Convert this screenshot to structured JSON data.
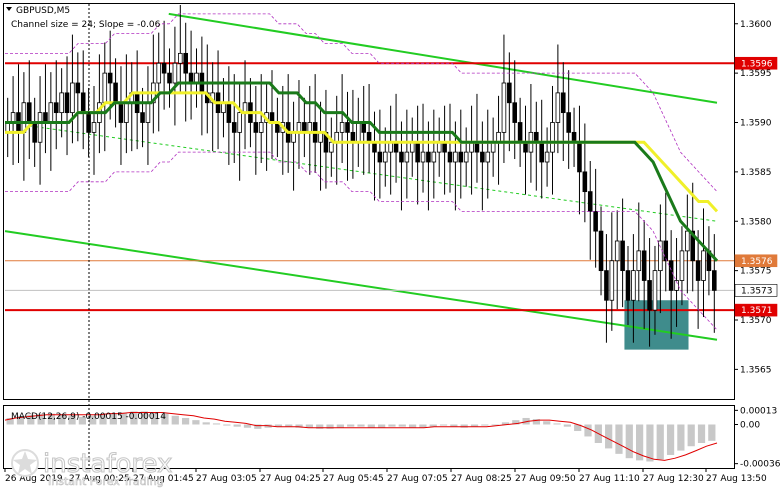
{
  "colors": {
    "background": "#ffffff",
    "bullish_bar": "#000000",
    "ema_fast": "#1a7a1a",
    "ema_slow": "#f0f02a",
    "channel": "#22cc22",
    "envelope": "#b030c0",
    "level": "#e00000",
    "current_level": "#e07a3a",
    "highlight_box": "#3f8c8c",
    "macd_hist": "#c8c8c8",
    "macd_signal": "#e00000"
  },
  "chart_data": [
    {
      "type": "candlestick",
      "title": "GBPUSD,M5",
      "subtitle": "Channel size = 24; Slope = -0.06",
      "ylim": [
        1.3562,
        1.3602
      ],
      "y_ticks": [
        "1.3600",
        "1.3595",
        "1.3590",
        "1.3585",
        "1.3580",
        "1.3575",
        "1.3570",
        "1.3565"
      ],
      "x_ticks": [
        "26 Aug 2019",
        "27 Aug 00:25",
        "27 Aug 01:45",
        "27 Aug 03:05",
        "27 Aug 04:25",
        "27 Aug 05:45",
        "27 Aug 07:05",
        "27 Aug 08:25",
        "27 Aug 09:50",
        "27 Aug 11:10",
        "27 Aug 12:30",
        "27 Aug 13:50"
      ],
      "price_tags": [
        {
          "name": "resistance",
          "value": "1.3596"
        },
        {
          "name": "current-level",
          "value": "1.3576"
        },
        {
          "name": "last-price",
          "value": "1.3573"
        },
        {
          "name": "support",
          "value": "1.3571"
        }
      ],
      "close_series": [
        1.359,
        1.3591,
        1.3589,
        1.3592,
        1.359,
        1.3588,
        1.3591,
        1.359,
        1.3592,
        1.3591,
        1.3593,
        1.3591,
        1.3594,
        1.3593,
        1.3591,
        1.3589,
        1.359,
        1.3592,
        1.3595,
        1.3594,
        1.3592,
        1.359,
        1.3592,
        1.3593,
        1.3591,
        1.359,
        1.3592,
        1.3594,
        1.3596,
        1.3595,
        1.3594,
        1.3596,
        1.3597,
        1.3595,
        1.3594,
        1.3595,
        1.3593,
        1.3592,
        1.3593,
        1.3591,
        1.3592,
        1.359,
        1.3589,
        1.3591,
        1.3592,
        1.359,
        1.3589,
        1.359,
        1.3591,
        1.359,
        1.3589,
        1.359,
        1.3588,
        1.3589,
        1.359,
        1.3589,
        1.359,
        1.3588,
        1.3589,
        1.3587,
        1.3588,
        1.3589,
        1.359,
        1.3589,
        1.3588,
        1.359,
        1.3589,
        1.3588,
        1.3587,
        1.3586,
        1.3587,
        1.3588,
        1.3587,
        1.3586,
        1.3587,
        1.3588,
        1.3586,
        1.3587,
        1.3586,
        1.3587,
        1.3588,
        1.3587,
        1.3586,
        1.3587,
        1.3586,
        1.3587,
        1.3588,
        1.3587,
        1.3586,
        1.3587,
        1.3588,
        1.3589,
        1.3594,
        1.3592,
        1.359,
        1.3588,
        1.3587,
        1.3589,
        1.3588,
        1.3586,
        1.3587,
        1.359,
        1.3593,
        1.3591,
        1.3589,
        1.3588,
        1.3585,
        1.3583,
        1.3581,
        1.3579,
        1.3575,
        1.3572,
        1.3576,
        1.3578,
        1.3575,
        1.3572,
        1.3575,
        1.3577,
        1.3574,
        1.3571,
        1.3575,
        1.3578,
        1.3576,
        1.3573,
        1.3574,
        1.3577,
        1.3579,
        1.3576,
        1.3574,
        1.3577,
        1.3575,
        1.3573
      ],
      "ema_fast": [
        1.359,
        1.359,
        1.359,
        1.359,
        1.359,
        1.359,
        1.359,
        1.359,
        1.3591,
        1.3591,
        1.3591,
        1.3591,
        1.3592,
        1.3592,
        1.3592,
        1.3592,
        1.3592,
        1.3593,
        1.3593,
        1.3594,
        1.3594,
        1.3594,
        1.3594,
        1.3594,
        1.3594,
        1.3594,
        1.3594,
        1.3594,
        1.3594,
        1.3594,
        1.3593,
        1.3593,
        1.3593,
        1.3592,
        1.3592,
        1.3591,
        1.3591,
        1.3591,
        1.359,
        1.359,
        1.359,
        1.3589,
        1.3589,
        1.3589,
        1.3589,
        1.3589,
        1.3589,
        1.3589,
        1.3589,
        1.3589,
        1.3588,
        1.3588,
        1.3588,
        1.3588,
        1.3588,
        1.3588,
        1.3588,
        1.3588,
        1.3588,
        1.3588,
        1.3588,
        1.3588,
        1.3588,
        1.3588,
        1.3588,
        1.3588,
        1.3588,
        1.3588,
        1.3588,
        1.3588,
        1.3587,
        1.3586,
        1.3584,
        1.3582,
        1.358,
        1.3579,
        1.3578,
        1.3577,
        1.3576
      ],
      "ema_slow": [
        1.3589,
        1.3589,
        1.3589,
        1.359,
        1.359,
        1.359,
        1.359,
        1.359,
        1.3591,
        1.3591,
        1.3591,
        1.3592,
        1.3592,
        1.3592,
        1.3593,
        1.3593,
        1.3593,
        1.3593,
        1.3593,
        1.3593,
        1.3593,
        1.3593,
        1.3593,
        1.3592,
        1.3592,
        1.3592,
        1.3591,
        1.3591,
        1.3591,
        1.359,
        1.359,
        1.3589,
        1.3589,
        1.3589,
        1.3589,
        1.3589,
        1.3588,
        1.3588,
        1.3588,
        1.3588,
        1.3588,
        1.3588,
        1.3588,
        1.3588,
        1.3588,
        1.3588,
        1.3588,
        1.3588,
        1.3588,
        1.3588,
        1.3588,
        1.3588,
        1.3588,
        1.3588,
        1.3588,
        1.3588,
        1.3588,
        1.3588,
        1.3588,
        1.3588,
        1.3588,
        1.3588,
        1.3588,
        1.3588,
        1.3588,
        1.3588,
        1.3588,
        1.3588,
        1.3588,
        1.3588,
        1.3588,
        1.3587,
        1.3586,
        1.3585,
        1.3584,
        1.3583,
        1.3582,
        1.3582,
        1.3581
      ],
      "levels": {
        "resistance": 1.3596,
        "current": 1.3576,
        "last": 1.3573,
        "support": 1.3571
      },
      "upper_channel": [
        [
          0.23,
          1.3601
        ],
        [
          1.0,
          1.3592
        ]
      ],
      "mid_channel": [
        [
          0.0,
          1.359
        ],
        [
          1.0,
          1.358
        ]
      ],
      "lower_channel": [
        [
          0.0,
          1.3579
        ],
        [
          1.0,
          1.3568
        ]
      ],
      "highlight_zone": {
        "from": 0.87,
        "to": 0.96,
        "y_top": 1.3572,
        "y_bottom": 1.3567
      }
    },
    {
      "type": "bar",
      "title": "MACD(12,26,9) -0.00015 -0.00014",
      "ylim": [
        -0.0004,
        0.00017
      ],
      "y_ticks": [
        "0.00013",
        "0.00",
        "-0.00036"
      ],
      "histogram": [
        6e-05,
        8e-05,
        9e-05,
        0.0001,
        0.0001,
        9e-05,
        8e-05,
        7e-05,
        8e-05,
        9e-05,
        0.0001,
        0.00011,
        0.00012,
        0.00012,
        0.00011,
        0.0001,
        8e-05,
        6e-05,
        4e-05,
        2e-05,
        1e-05,
        -1e-05,
        -2e-05,
        -3e-05,
        -4e-05,
        -3e-05,
        -2e-05,
        -2e-05,
        -3e-05,
        -3e-05,
        -4e-05,
        -4e-05,
        -3e-05,
        -2e-05,
        -2e-05,
        -3e-05,
        -3e-05,
        -2e-05,
        -2e-05,
        -3e-05,
        -3e-05,
        -2e-05,
        -1e-05,
        -2e-05,
        -3e-05,
        -2e-05,
        -1e-05,
        0.0,
        2e-05,
        4e-05,
        6e-05,
        5e-05,
        3e-05,
        1e-05,
        -2e-05,
        -6e-05,
        -0.00011,
        -0.00017,
        -0.00022,
        -0.00027,
        -0.00031,
        -0.00033,
        -0.00034,
        -0.00032,
        -0.00028,
        -0.00024,
        -0.0002,
        -0.00017,
        -0.00015
      ],
      "signal": [
        4e-05,
        6e-05,
        7e-05,
        8e-05,
        9e-05,
        9e-05,
        9e-05,
        9e-05,
        9e-05,
        9e-05,
        0.0001,
        0.0001,
        0.00011,
        0.00011,
        0.00011,
        0.00011,
        0.0001,
        9e-05,
        8e-05,
        6e-05,
        5e-05,
        3e-05,
        2e-05,
        1e-05,
        -1e-05,
        -1e-05,
        -2e-05,
        -2e-05,
        -2e-05,
        -3e-05,
        -3e-05,
        -3e-05,
        -3e-05,
        -3e-05,
        -3e-05,
        -3e-05,
        -3e-05,
        -3e-05,
        -3e-05,
        -3e-05,
        -3e-05,
        -2e-05,
        -2e-05,
        -2e-05,
        -2e-05,
        -2e-05,
        -2e-05,
        -1e-05,
        0.0,
        1e-05,
        3e-05,
        4e-05,
        4e-05,
        3e-05,
        2e-05,
        -1e-05,
        -5e-05,
        -0.0001,
        -0.00015,
        -0.0002,
        -0.00025,
        -0.00029,
        -0.00032,
        -0.00033,
        -0.00031,
        -0.00028,
        -0.00024,
        -0.0002,
        -0.00017
      ]
    }
  ],
  "watermark": {
    "brand": "instaforex",
    "tagline": "Instant Forex Trading"
  }
}
